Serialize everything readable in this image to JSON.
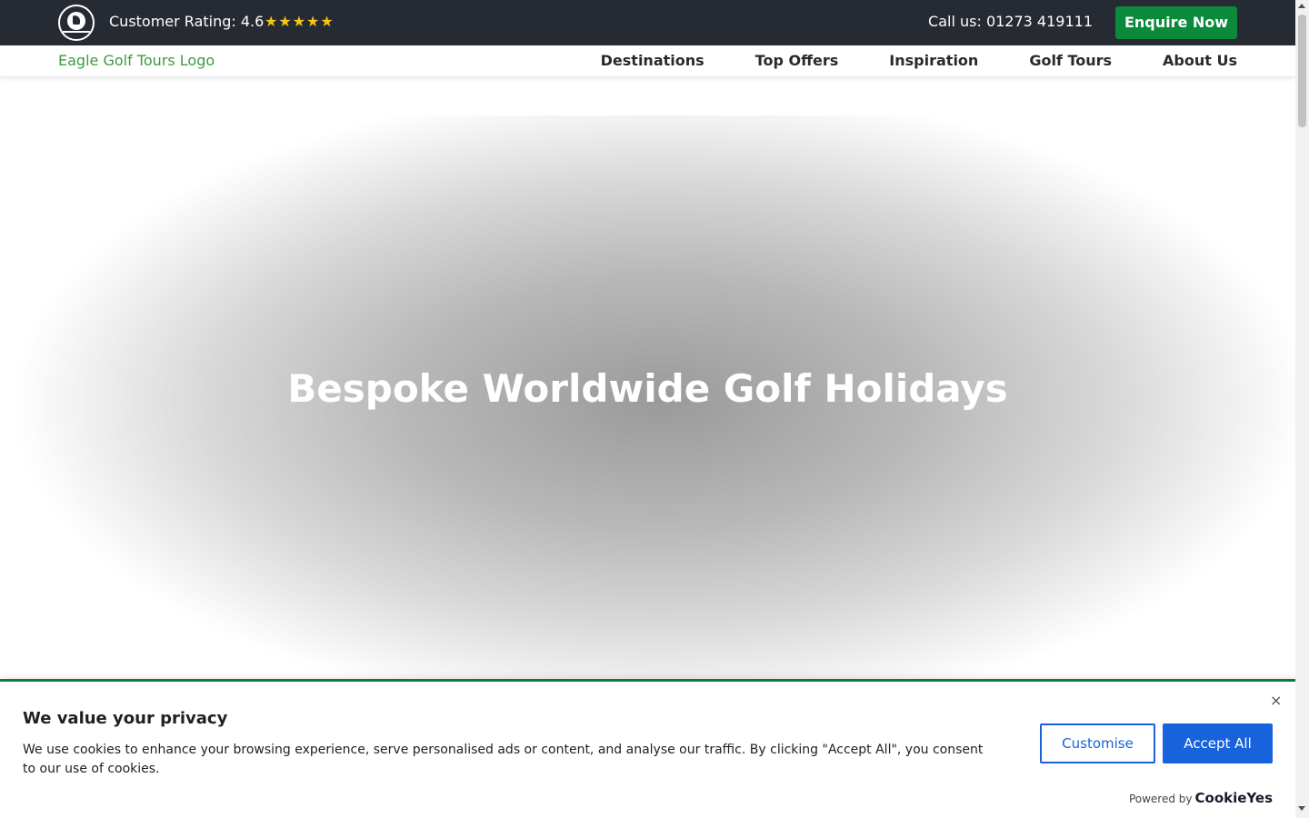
{
  "topbar": {
    "rating_text": "Customer Rating: 4.6",
    "stars": "★★★★★",
    "call_text": "Call us: 01273 419111",
    "enquire_label": "Enquire Now"
  },
  "navbar": {
    "logo_alt": "Eagle Golf Tours Logo",
    "items": [
      "Destinations",
      "Top Offers",
      "Inspiration",
      "Golf Tours",
      "About Us"
    ]
  },
  "hero": {
    "heading": "Bespoke Worldwide Golf Holidays"
  },
  "cookie": {
    "title": "We value your privacy",
    "message": "We use cookies to enhance your browsing experience, serve personalised ads or content, and analyse our traffic. By clicking \"Accept All\", you consent to our use of cookies.",
    "close": "×",
    "customise_label": "Customise",
    "accept_label": "Accept All",
    "powered_by": "Powered by",
    "brand": "CookieYes"
  },
  "colors": {
    "topbar_bg": "#262a33",
    "accent_green": "#0a8a3a",
    "cookie_blue": "#1863dc",
    "star_yellow": "#f5c518"
  }
}
